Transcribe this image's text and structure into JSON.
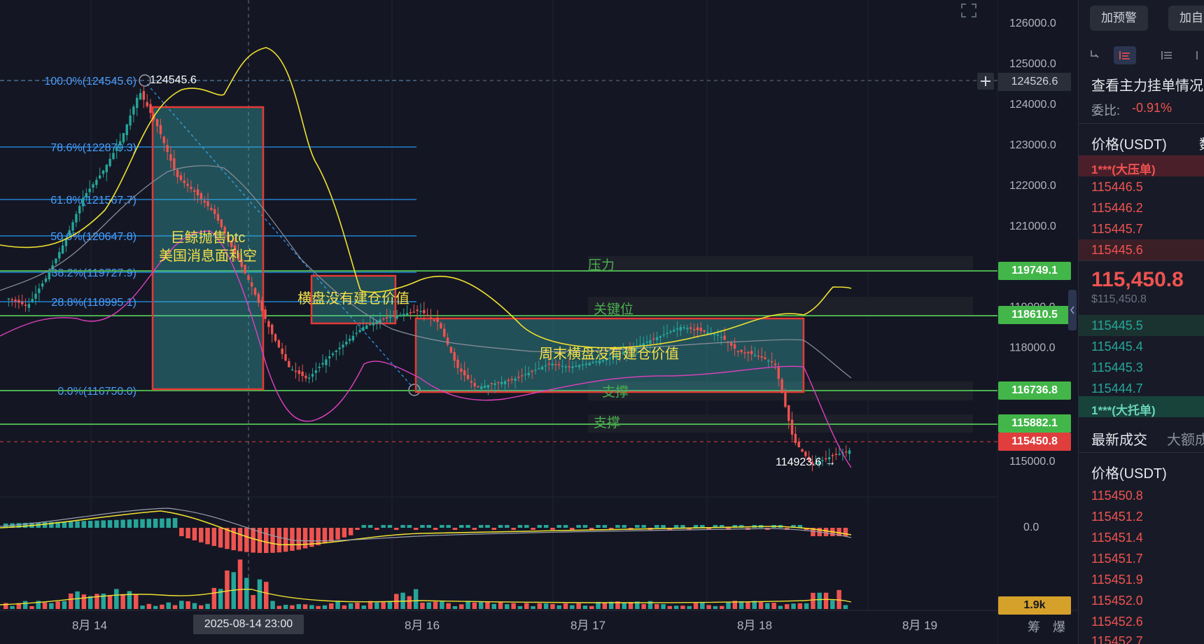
{
  "price_axis": {
    "labels": [
      "126000.0",
      "125000.0",
      "124000.0",
      "123000.0",
      "122000.0",
      "121000.0",
      "120000.0",
      "119000.0",
      "118000.0",
      "117000.0",
      "115000.0"
    ],
    "macd_zero": "0.0",
    "vol_tag": "1.9k",
    "crosshair_price": "124526.6",
    "current_price": "115450.8"
  },
  "level_tags": [
    "119749.1",
    "118610.5",
    "116736.8",
    "115882.1"
  ],
  "time_axis": {
    "labels": [
      "8月 14",
      "8月 16",
      "8月 17",
      "8月 18",
      "8月 19"
    ],
    "crosshair_time": "2025-08-14 23:00",
    "footer_buttons": [
      "筹",
      "爆"
    ]
  },
  "fibonacci": [
    "100.0%(124545.6)",
    "78.6%(122879.3)",
    "61.8%(121567.7)",
    "50.0%(120647.8)",
    "38.2%(119727.9)",
    "28.8%(118995.1)",
    "0.0%(116750.0)"
  ],
  "annotations": {
    "high_label": "124545.6",
    "low_label": "114923.6",
    "box1_line1": "巨鲸抛售btc",
    "box1_line2": "美国消息面利空",
    "box2": "横盘没有建仓价值",
    "box3": "周末横盘没有建仓价值",
    "resistance": "压力",
    "key_level": "关键位",
    "support1": "支撑",
    "support2": "支撑"
  },
  "panel": {
    "btn_alert": "加预警",
    "btn_watch": "加自选",
    "title": "查看主力挂单情况",
    "ratio_label": "委比:",
    "ratio_value": "-0.91%",
    "col_price": "价格(USDT)",
    "col_qty": "数",
    "ask_badge": "1***(大压单)",
    "asks": [
      "115446.5",
      "115446.2",
      "115445.7",
      "115445.6"
    ],
    "last_price": "115,450.8",
    "last_price_usd": "$115,450.8",
    "bids": [
      "115445.5",
      "115445.4",
      "115445.3",
      "115444.7"
    ],
    "bid_badge": "1***(大托单)",
    "tab_latest": "最新成交",
    "tab_large": "大额成",
    "trade_col": "价格(USDT)",
    "trades": [
      "115450.8",
      "115451.2",
      "115451.4",
      "115451.7",
      "115451.9",
      "115452.0",
      "115452.6",
      "115452.7"
    ]
  },
  "colors": {
    "up": "#26a69a",
    "down": "#ef5350",
    "level_line": "#4caf50",
    "fib_line": "#2196f3",
    "annotation_text": "#f5e04a",
    "box_border": "#e53935"
  },
  "chart_data": {
    "type": "candlestick",
    "symbol_quote": "USDT",
    "y_range": [
      114600,
      126400
    ],
    "time_labels": [
      "8月 14",
      "8月 16",
      "8月 17",
      "8月 18",
      "8月 19"
    ],
    "swing_high": 124545.6,
    "swing_low": 114923.6,
    "current": 115450.8,
    "levels": [
      119749.1,
      118610.5,
      116736.8,
      115882.1
    ],
    "key_closes": [
      119200,
      119000,
      119700,
      120600,
      121700,
      122300,
      123100,
      124300,
      123400,
      122200,
      121800,
      121300,
      120400,
      119500,
      118400,
      117500,
      117200,
      117700,
      118100,
      118500,
      118700,
      118800,
      118900,
      118600,
      117500,
      117000,
      117100,
      117200,
      117400,
      117600,
      117500,
      117600,
      117700,
      117900,
      118100,
      118300,
      118500,
      118400,
      118300,
      117900,
      117800,
      117600,
      115700,
      115100,
      115300,
      115450.8
    ]
  }
}
